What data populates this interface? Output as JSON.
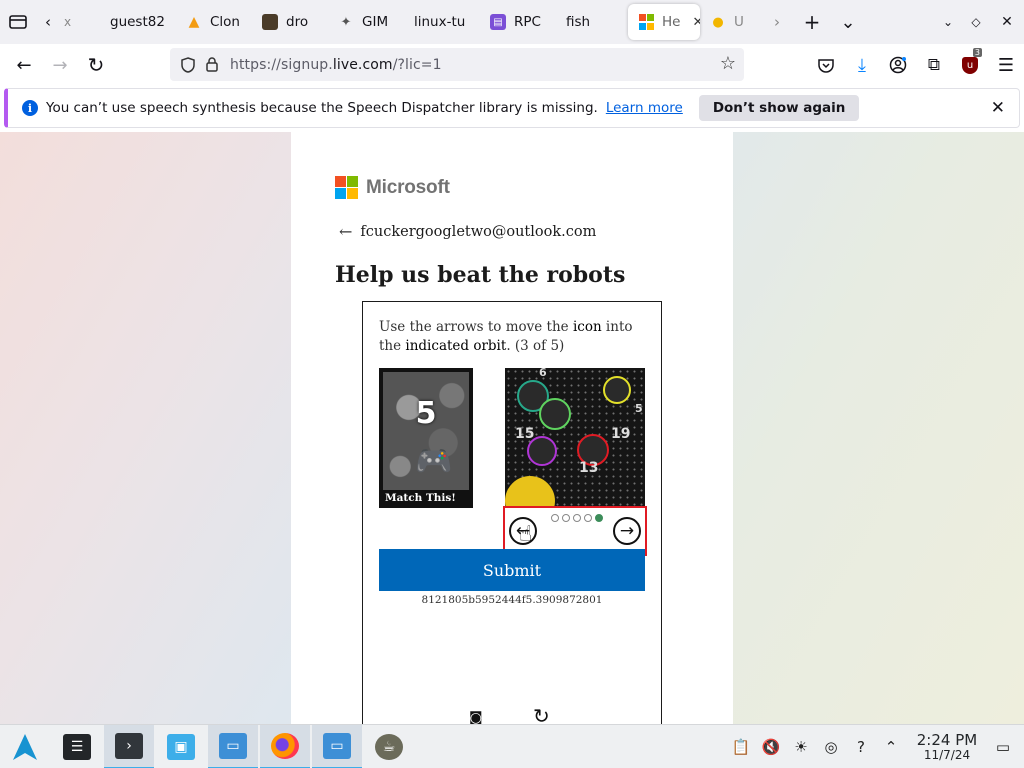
{
  "tabbar": {
    "tabs": [
      {
        "label": "x",
        "favicon": "back-icon"
      },
      {
        "label": "guest82",
        "favicon": ""
      },
      {
        "label": "Clon",
        "favicon": "flame-icon"
      },
      {
        "label": "dro",
        "favicon": "image-icon"
      },
      {
        "label": "GIM",
        "favicon": "gimp-icon"
      },
      {
        "label": "linux-tu",
        "favicon": ""
      },
      {
        "label": "RPC",
        "favicon": "rpc-icon"
      },
      {
        "label": "fish",
        "favicon": ""
      },
      {
        "label": "He",
        "favicon": "microsoft-icon"
      },
      {
        "label": "U",
        "favicon": "bell-icon"
      }
    ],
    "list_all_tabs": "⌄"
  },
  "navbar": {
    "url_prefix": "https://signup.",
    "url_domain": "live.com",
    "url_suffix": "/?lic=1",
    "extension_badge": "3"
  },
  "notification": {
    "message": "You can’t use speech synthesis because the Speech Dispatcher library is missing.",
    "learn_more": "Learn more",
    "dont_show": "Don’t show again"
  },
  "signup": {
    "brand": "Microsoft",
    "email": "fcuckergoogletwo@outlook.com",
    "heading": "Help us beat the robots",
    "instruction_part1": "Use the arrows to move the ",
    "instruction_icon": "icon",
    "instruction_part2": " into the ",
    "instruction_orbit": "indicated orbit",
    "instruction_part3": ". (3 of 5)",
    "match_number": "5",
    "match_label": "Match This!",
    "scene_numbers": [
      "6",
      "15",
      "19",
      "13",
      "5"
    ],
    "pager_total": 5,
    "pager_active": 5,
    "submit": "Submit",
    "session_id": "8121805b5952444f5.3909872801"
  },
  "colors": {
    "ms_red": "#f25022",
    "ms_green": "#7fba00",
    "ms_blue": "#00a4ef",
    "ms_yellow": "#ffb900",
    "submit_bg": "#0067b8",
    "highlight_border": "#e01b24",
    "notification_accent": "#b45af0"
  },
  "taskbar": {
    "time": "2:24 PM",
    "date": "11/7/24"
  }
}
